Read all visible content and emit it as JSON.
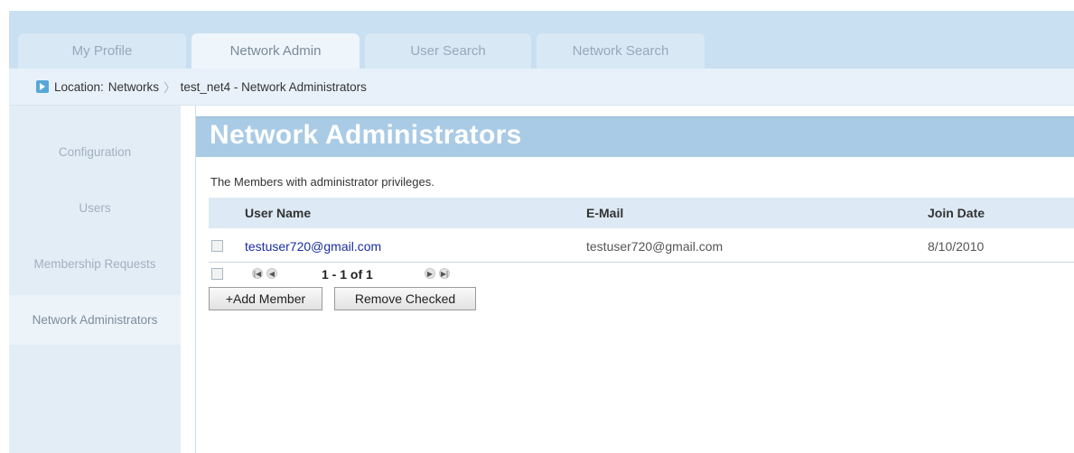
{
  "tabs": [
    {
      "label": "My Profile",
      "active": false
    },
    {
      "label": "Network Admin",
      "active": true
    },
    {
      "label": "User Search",
      "active": false
    },
    {
      "label": "Network Search",
      "active": false
    }
  ],
  "breadcrumb": {
    "prefix": "Location:",
    "items": [
      "Networks",
      "test_net4 - Network Administrators"
    ],
    "separator": "〉"
  },
  "sidebar": {
    "items": [
      {
        "label": "Configuration",
        "active": false
      },
      {
        "label": "Users",
        "active": false
      },
      {
        "label": "Membership Requests",
        "active": false
      },
      {
        "label": "Network Administrators",
        "active": true
      }
    ]
  },
  "main": {
    "title": "Network Administrators",
    "description": "The Members with administrator privileges.",
    "table": {
      "columns": [
        "User Name",
        "E-Mail",
        "Join Date"
      ],
      "rows": [
        {
          "user_name": "testuser720@gmail.com",
          "email": "testuser720@gmail.com",
          "join_date": "8/10/2010",
          "checked": false
        }
      ]
    },
    "pager": {
      "range": "1 - 1 of 1"
    },
    "buttons": {
      "add": "+Add Member",
      "remove": "Remove Checked"
    }
  },
  "colors": {
    "tab_band": "#c9e0f2",
    "title_bar": "#a9cbe5",
    "link": "#1a2ea0",
    "table_header": "#ddeaf5"
  }
}
